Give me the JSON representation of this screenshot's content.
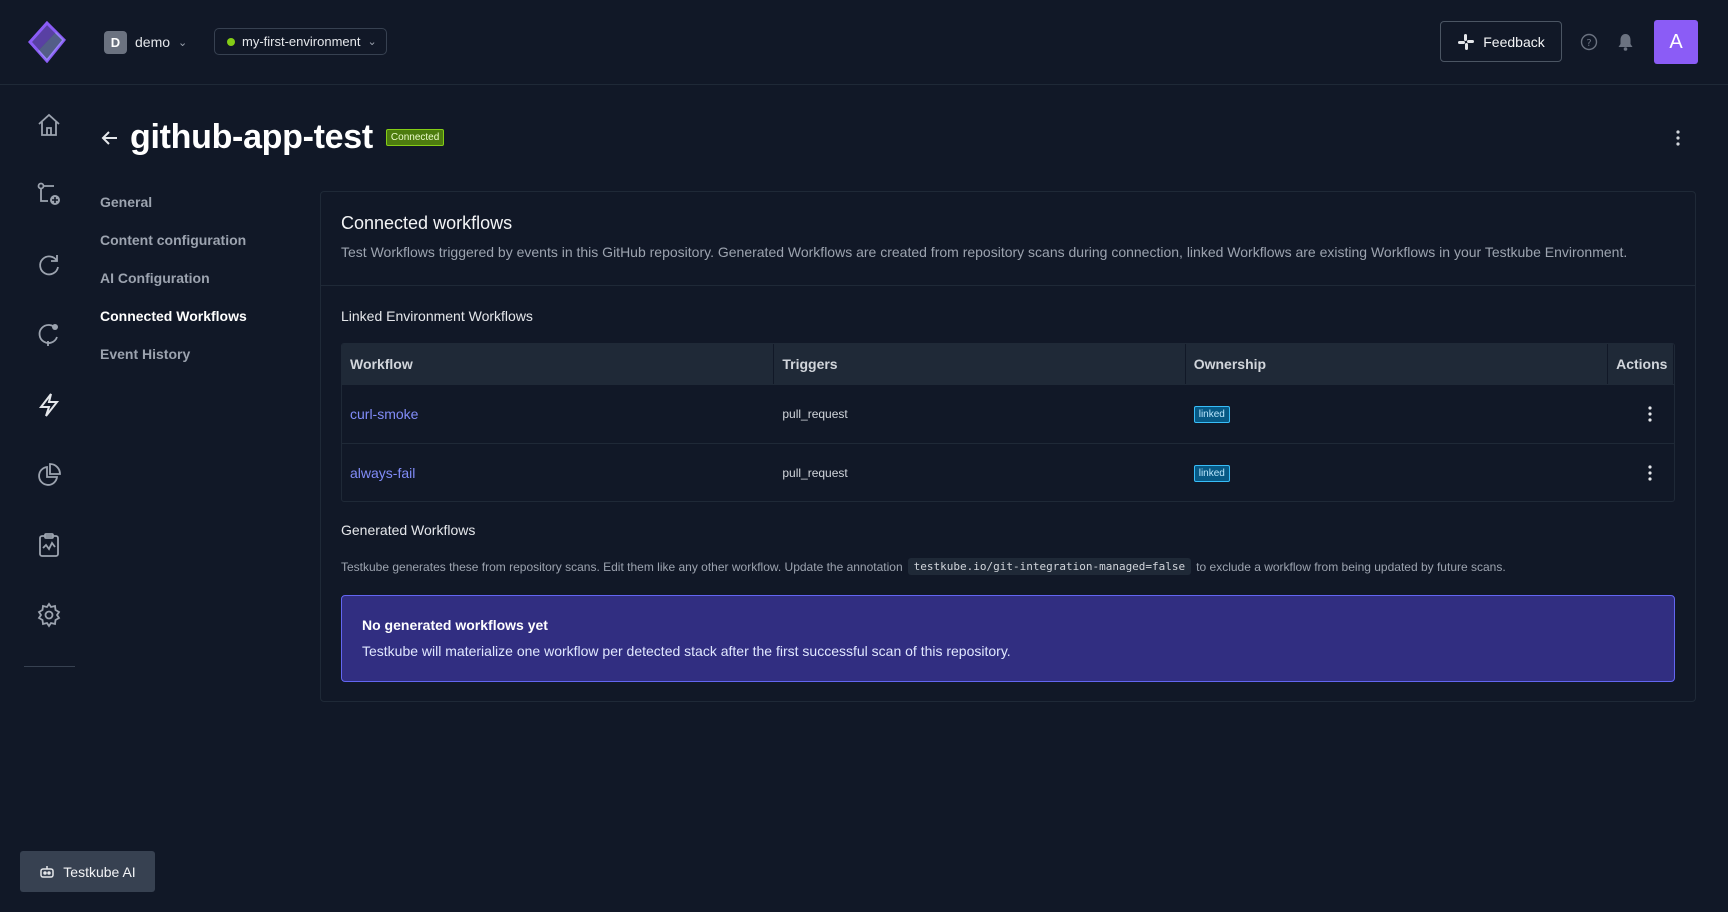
{
  "topbar": {
    "org_initial": "D",
    "org_name": "demo",
    "environment": "my-first-environment",
    "feedback_label": "Feedback",
    "user_initial": "A"
  },
  "rail": {
    "icons": [
      "home-icon",
      "add-workflow-icon",
      "refresh-icon",
      "triggers-icon",
      "lightning-icon",
      "pie-chart-icon",
      "clipboard-icon",
      "gear-icon"
    ]
  },
  "page": {
    "title": "github-app-test",
    "status": "Connected"
  },
  "subnav": {
    "items": [
      {
        "label": "General"
      },
      {
        "label": "Content configuration"
      },
      {
        "label": "AI Configuration"
      },
      {
        "label": "Connected Workflows"
      },
      {
        "label": "Event History"
      }
    ],
    "active": "Connected Workflows"
  },
  "panel": {
    "title": "Connected workflows",
    "description": "Test Workflows triggered by events in this GitHub repository. Generated Workflows are created from repository scans during connection, linked Workflows are existing Workflows in your Testkube Environment.",
    "linked_title": "Linked Environment Workflows",
    "table": {
      "headers": [
        "Workflow",
        "Triggers",
        "Ownership",
        "Actions"
      ],
      "rows": [
        {
          "workflow": "curl-smoke",
          "trigger": "pull_request",
          "ownership": "linked"
        },
        {
          "workflow": "always-fail",
          "trigger": "pull_request",
          "ownership": "linked"
        }
      ]
    },
    "generated_title": "Generated Workflows",
    "generated_desc_pre": "Testkube generates these from repository scans. Edit them like any other workflow. Update the annotation",
    "generated_code": "testkube.io/git-integration-managed=false",
    "generated_desc_post": "to exclude a workflow from being updated by future scans.",
    "empty_title": "No generated workflows yet",
    "empty_desc": "Testkube will materialize one workflow per detected stack after the first successful scan of this repository."
  },
  "ai_button": "Testkube AI",
  "colors": {
    "background": "#111827",
    "accent": "#8b5cf6",
    "link": "#818cf8",
    "connected_badge": "#4d7c0f",
    "linked_badge": "#075985",
    "empty_state": "#312e81"
  }
}
